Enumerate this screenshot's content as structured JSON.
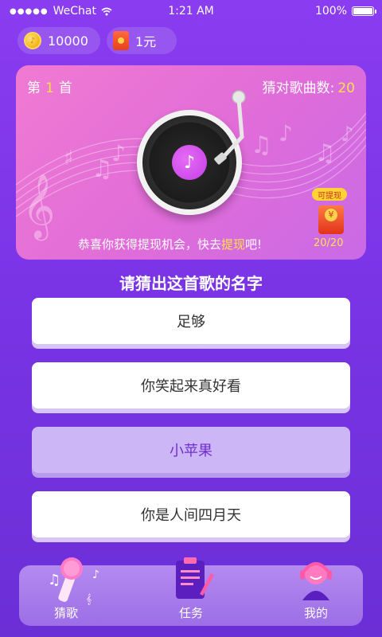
{
  "status_bar": {
    "carrier": "WeChat",
    "time": "1:21 AM",
    "battery": "100%"
  },
  "wallet": {
    "coins": "10000",
    "cash": "1元"
  },
  "card": {
    "level_prefix": "第",
    "level_number": "1",
    "level_suffix": "首",
    "score_label": "猜对歌曲数:",
    "score_value": "20",
    "congrats_prefix": "恭喜你获得提现机会，快去",
    "congrats_highlight": "提现",
    "congrats_suffix": "吧!",
    "withdraw_badge": "可提现",
    "progress": "20/20"
  },
  "question": "请猜出这首歌的名字",
  "answers": [
    {
      "label": "足够",
      "selected": false
    },
    {
      "label": "你笑起来真好看",
      "selected": false
    },
    {
      "label": "小苹果",
      "selected": true
    },
    {
      "label": "你是人间四月天",
      "selected": false
    }
  ],
  "nav": {
    "items": [
      {
        "label": "猜歌",
        "icon": "microphone-icon",
        "active": true
      },
      {
        "label": "任务",
        "icon": "clipboard-icon",
        "active": false
      },
      {
        "label": "我的",
        "icon": "profile-icon",
        "active": false
      }
    ]
  },
  "colors": {
    "background": "#7a34e6",
    "accent_yellow": "#ffe04a",
    "selected_answer": "#cdb6f6"
  }
}
